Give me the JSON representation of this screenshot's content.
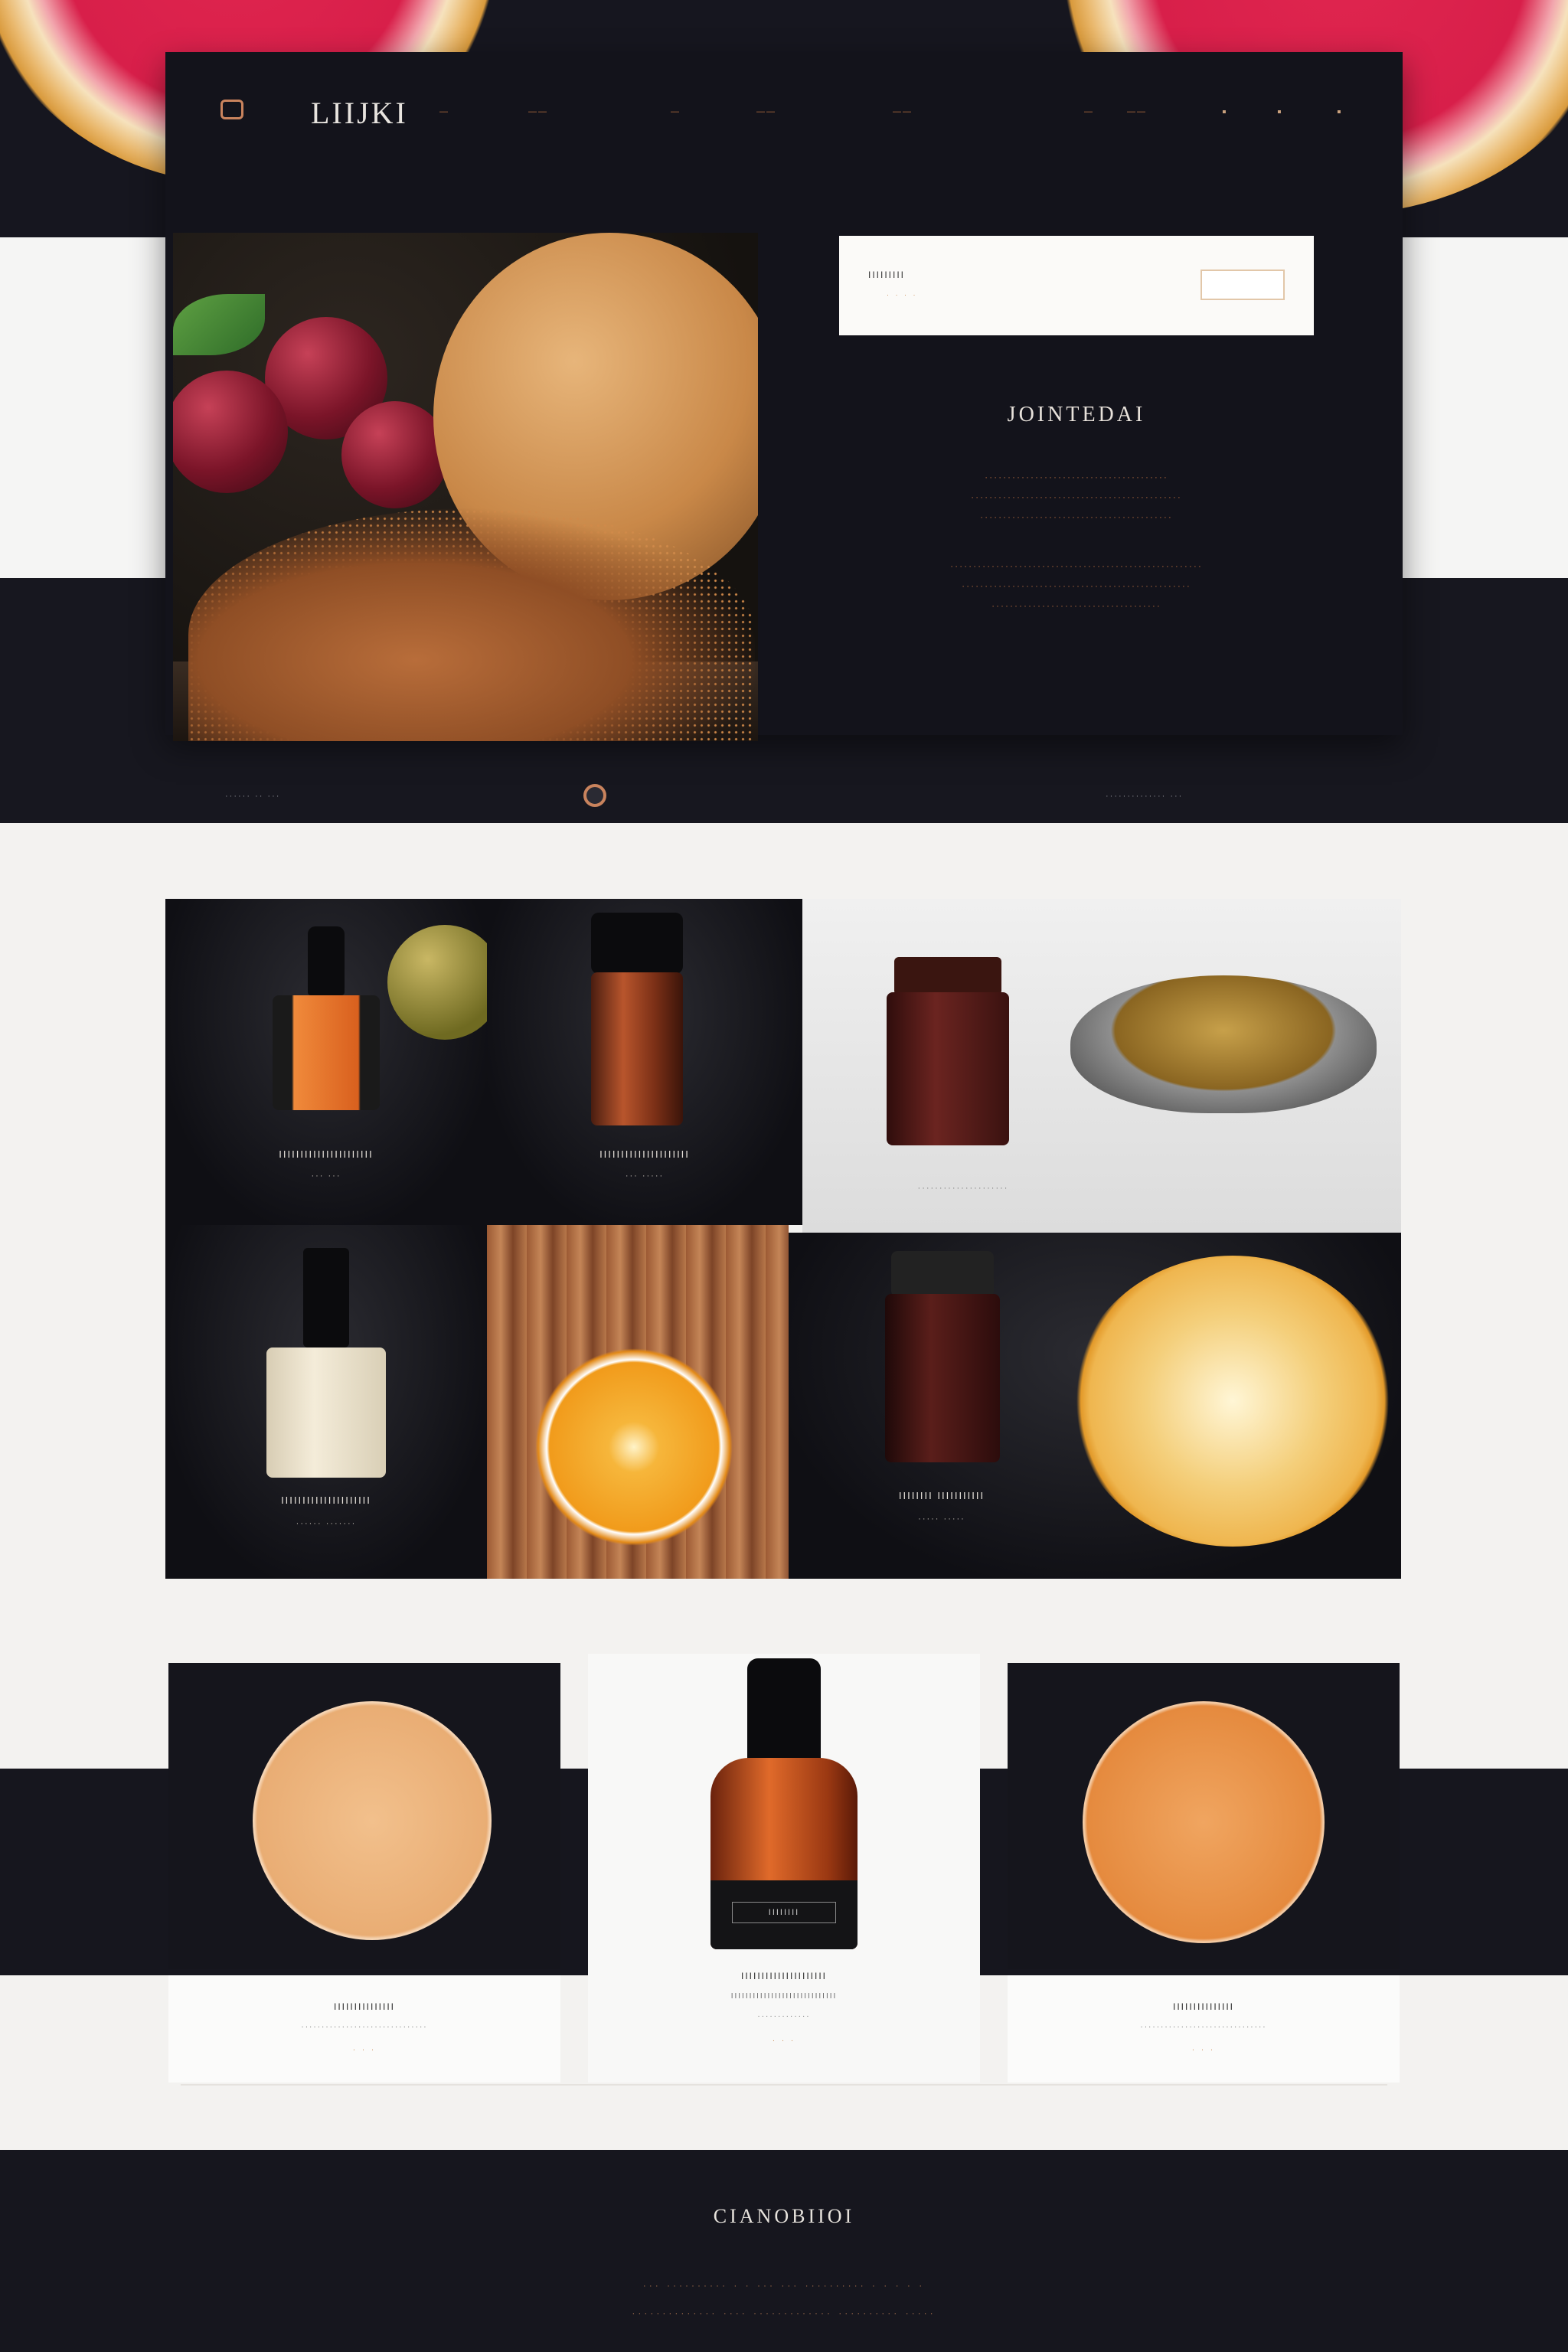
{
  "nav": {
    "brand": "LIIJKI",
    "items": [
      "—",
      "——",
      "—",
      "——",
      "——",
      "—",
      "——"
    ],
    "icons": [
      "search-icon",
      "user-icon",
      "cart-icon"
    ]
  },
  "hero": {
    "card_title": "IIIIIIIII",
    "card_sub": "· · · ·",
    "title": "JOINTEDAI",
    "lines": [
      "········································",
      "··············································",
      "··········································",
      "·······················································",
      "··················································",
      "·····································"
    ]
  },
  "below": {
    "left": "······ ·· ···",
    "right": "·············· ···"
  },
  "grid": {
    "captions": [
      {
        "line1": "IIIIIIIIIIIIIIIIIIIIII",
        "line2": "··· ···"
      },
      {
        "line1": "IIIIIIIIIIIIIIIIIIIII",
        "line2": "··· ·····"
      },
      {
        "line1": "·····················",
        "line2": ""
      },
      {
        "line1": "IIIIIIIIIIIIIIIIIIIII",
        "line2": "······ ·······"
      },
      {
        "line1": "IIIIIIII IIIIIIIIIII",
        "line2": "····· ·····"
      }
    ]
  },
  "showcase": [
    {
      "title": "IIIIIIIIIIIIIII",
      "line": "·······························",
      "price": "· · ·"
    },
    {
      "title": "IIIIIIIIIIIIIIIIIIIII",
      "line": "IIIIIIIIIIIIIIIIIIIIIIIIIIIII",
      "line2": "·············",
      "price": "· · ·",
      "label": "IIIIIIII"
    },
    {
      "title": "IIIIIIIIIIIIIII",
      "line": "·······························",
      "price": "· · ·"
    }
  ],
  "footer": {
    "title": "CIANOBIIOI",
    "lines": [
      "··· ·········· · · ··· ··· ·········· · · · · ·",
      "·············· ···· ············· ·········· ·····"
    ]
  },
  "colors": {
    "dark": "#16161e",
    "accent": "#c9835d",
    "light": "#f3f2f0"
  }
}
